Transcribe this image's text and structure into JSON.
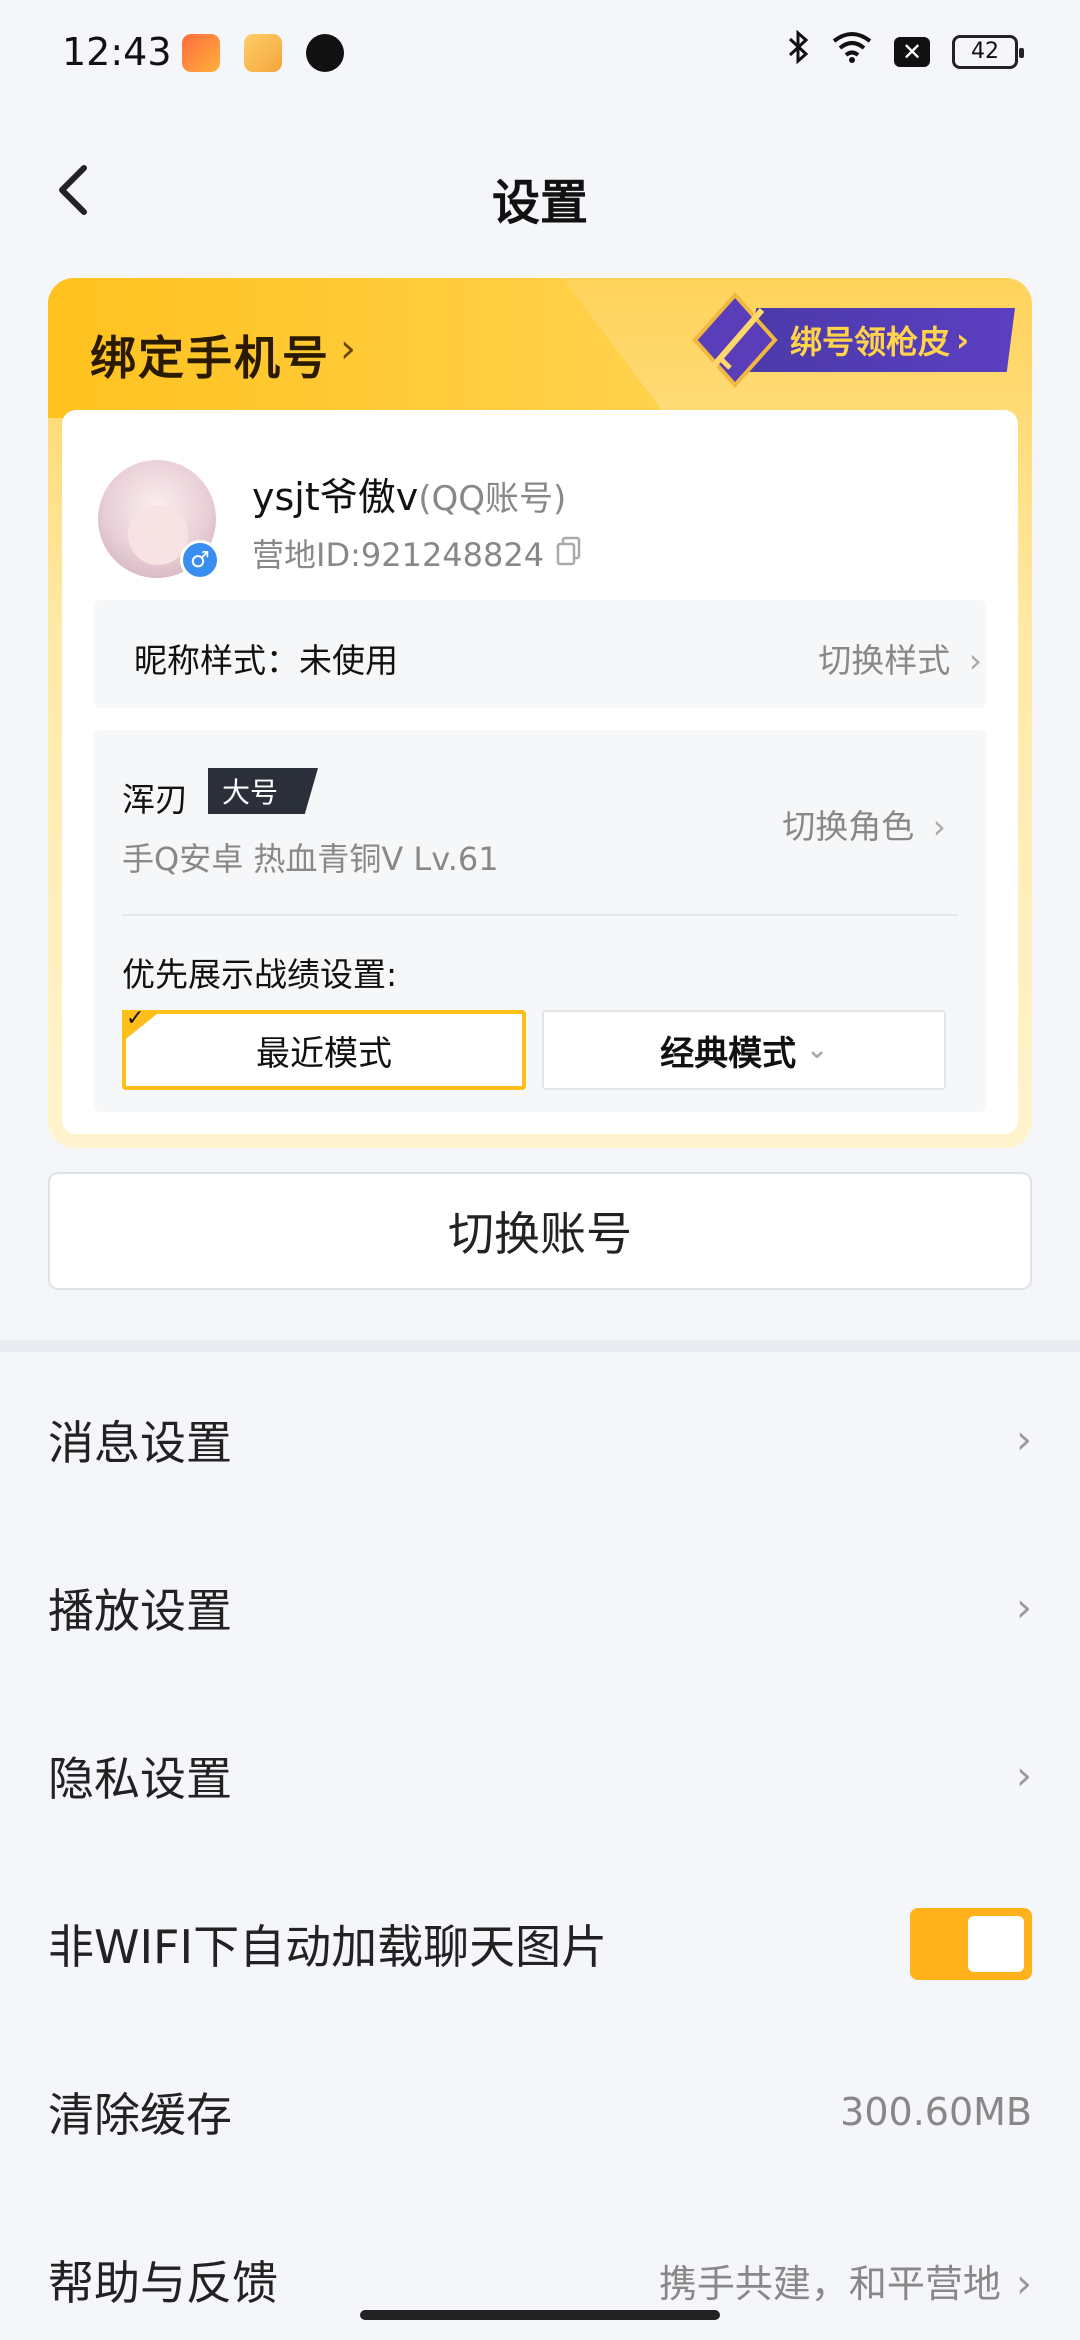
{
  "status_bar": {
    "time": "12:43",
    "battery": "42",
    "icons": [
      "bluetooth-icon",
      "wifi-icon",
      "x-box-icon",
      "battery-icon"
    ]
  },
  "header": {
    "title": "设置"
  },
  "bind_card": {
    "title": "绑定手机号",
    "promo": "绑号领枪皮",
    "user": {
      "name": "ysjt爷傲v",
      "account_tag": "(QQ账号)",
      "camp_id": "营地ID:921248824"
    },
    "nickname_style": {
      "label": "昵称样式：未使用",
      "action": "切换样式"
    },
    "role": {
      "name": "浑刃",
      "badge": "大号",
      "info": "手Q安卓  热血青铜V  Lv.61",
      "action": "切换角色"
    },
    "record_pref": {
      "label": "优先展示战绩设置:",
      "options": [
        "最近模式",
        "经典模式"
      ],
      "selected": "最近模式"
    }
  },
  "switch_account": "切换账号",
  "menu": [
    {
      "label": "消息设置"
    },
    {
      "label": "播放设置"
    },
    {
      "label": "隐私设置"
    },
    {
      "label": "非WIFI下自动加载聊天图片",
      "toggle": true
    },
    {
      "label": "清除缓存",
      "value": "300.60MB"
    },
    {
      "label": "帮助与反馈",
      "value": "携手共建，和平营地"
    }
  ],
  "colors": {
    "accent": "#ffb21a",
    "background": "#f4f6fa"
  }
}
